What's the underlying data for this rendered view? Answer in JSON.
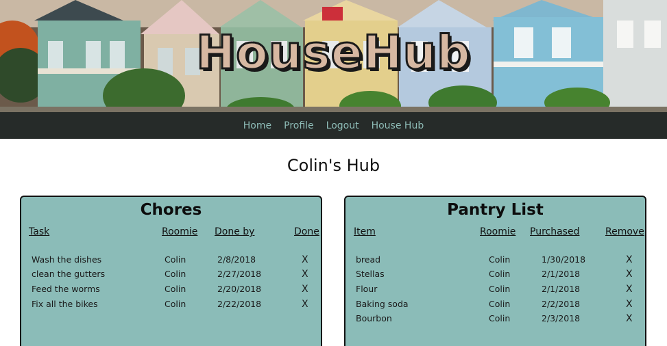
{
  "app": {
    "logo": "HouseHub"
  },
  "nav": {
    "items": [
      {
        "label": "Home"
      },
      {
        "label": "Profile"
      },
      {
        "label": "Logout"
      },
      {
        "label": "House Hub"
      }
    ]
  },
  "page": {
    "title": "Colin's Hub"
  },
  "chores": {
    "title": "Chores",
    "headers": {
      "task": "Task",
      "roomie": "Roomie",
      "done_by": "Done by",
      "done": "Done"
    },
    "rows": [
      {
        "task": "Wash the dishes",
        "roomie": "Colin",
        "date": "2/8/2018",
        "action": "X"
      },
      {
        "task": "clean the gutters",
        "roomie": "Colin",
        "date": "2/27/2018",
        "action": "X"
      },
      {
        "task": "Feed the worms",
        "roomie": "Colin",
        "date": "2/20/2018",
        "action": "X"
      },
      {
        "task": "Fix all the bikes",
        "roomie": "Colin",
        "date": "2/22/2018",
        "action": "X"
      }
    ]
  },
  "pantry": {
    "title": "Pantry List",
    "headers": {
      "item": "Item",
      "roomie": "Roomie",
      "purchased": "Purchased",
      "remove": "Remove"
    },
    "rows": [
      {
        "item": "bread",
        "roomie": "Colin",
        "date": "1/30/2018",
        "action": "X"
      },
      {
        "item": "Stellas",
        "roomie": "Colin",
        "date": "2/1/2018",
        "action": "X"
      },
      {
        "item": "Flour",
        "roomie": "Colin",
        "date": "2/1/2018",
        "action": "X"
      },
      {
        "item": "Baking soda",
        "roomie": "Colin",
        "date": "2/2/2018",
        "action": "X"
      },
      {
        "item": "Bourbon",
        "roomie": "Colin",
        "date": "2/3/2018",
        "action": "X"
      }
    ]
  },
  "colors": {
    "nav_bg": "#262b29",
    "nav_link": "#8ebcb7",
    "panel_bg": "#8bbcb8",
    "logo_fill": "#d7b8a2"
  }
}
